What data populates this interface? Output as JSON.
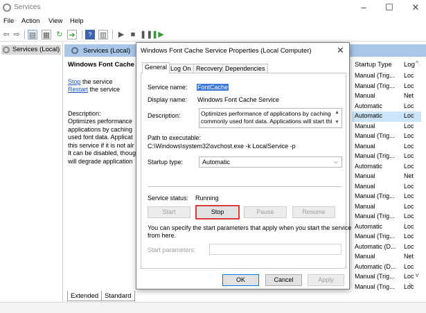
{
  "window": {
    "title": "Services",
    "controls": {
      "minimize": "–",
      "maximize": "☐",
      "close": "✕"
    }
  },
  "menu": [
    "File",
    "Action",
    "View",
    "Help"
  ],
  "tree": {
    "item": "Services (Local)"
  },
  "pane": {
    "header": "Services (Local)",
    "service_name": "Windows Font Cache Se",
    "stop_link": "Stop",
    "stop_rest": " the service",
    "restart_link": "Restart",
    "restart_rest": " the service",
    "description_label": "Description:",
    "description_lines": [
      "Optimizes performance",
      "applications by caching",
      "used font data. Applicat",
      "this service if it is not alr",
      "It can be disabled, thoug",
      "will degrade application"
    ]
  },
  "list": {
    "columns": {
      "startup_type": "Startup Type",
      "log_on": "Log"
    },
    "sort_indicator": "^",
    "rows": [
      {
        "startup": "Manual (Trig...",
        "logon": "Loc"
      },
      {
        "startup": "Manual (Trig...",
        "logon": "Loc"
      },
      {
        "startup": "Manual",
        "logon": "Net"
      },
      {
        "startup": "Automatic",
        "logon": "Loc"
      },
      {
        "startup": "Automatic",
        "logon": "Loc"
      },
      {
        "startup": "Manual",
        "logon": "Loc"
      },
      {
        "startup": "Manual (Trig...",
        "logon": "Loc"
      },
      {
        "startup": "Manual",
        "logon": "Loc"
      },
      {
        "startup": "Manual (Trig...",
        "logon": "Loc"
      },
      {
        "startup": "Automatic",
        "logon": "Loc"
      },
      {
        "startup": "Manual",
        "logon": "Net"
      },
      {
        "startup": "Manual",
        "logon": "Loc"
      },
      {
        "startup": "Manual (Trig...",
        "logon": "Loc"
      },
      {
        "startup": "Manual",
        "logon": "Loc"
      },
      {
        "startup": "Manual (Trig...",
        "logon": "Loc"
      },
      {
        "startup": "Automatic",
        "logon": "Loc"
      },
      {
        "startup": "Manual (Trig...",
        "logon": "Loc"
      },
      {
        "startup": "Automatic (D...",
        "logon": "Loc"
      },
      {
        "startup": "Manual",
        "logon": "Net"
      },
      {
        "startup": "Automatic (D...",
        "logon": "Loc"
      },
      {
        "startup": "Manual (Trig...",
        "logon": "Loc"
      },
      {
        "startup": "Manual (Trig...",
        "logon": "Loc"
      }
    ],
    "selected_index": 4,
    "scroll_down": "v",
    "scroll_right": ">"
  },
  "bottom_tabs": [
    "Extended",
    "Standard"
  ],
  "dialog": {
    "title": "Windows Font Cache Service Properties (Local Computer)",
    "close": "✕",
    "tabs": [
      "General",
      "Log On",
      "Recovery",
      "Dependencies"
    ],
    "active_tab": 0,
    "service_name_label": "Service name:",
    "service_name_value": "FontCache",
    "display_name_label": "Display name:",
    "display_name_value": "Windows Font Cache Service",
    "description_label": "Description:",
    "description_lines": [
      "Optimizes performance of applications by caching",
      "commonly used font data. Applications will start this"
    ],
    "path_label": "Path to executable:",
    "path_value": "C:\\Windows\\system32\\svchost.exe -k LocalService -p",
    "startup_type_label": "Startup type:",
    "startup_type_value": "Automatic",
    "service_status_label": "Service status:",
    "service_status_value": "Running",
    "buttons": {
      "start": "Start",
      "stop": "Stop",
      "pause": "Pause",
      "resume": "Resume"
    },
    "params_hint_lines": [
      "You can specify the start parameters that apply when you start the service",
      "from here."
    ],
    "start_params_label": "Start parameters:",
    "start_params_value": "",
    "footer": {
      "ok": "OK",
      "cancel": "Cancel",
      "apply": "Apply"
    }
  },
  "colors": {
    "pane_header": "#a9c6e8",
    "selection": "#3a77d9",
    "highlight_box": "#d93a3a"
  }
}
